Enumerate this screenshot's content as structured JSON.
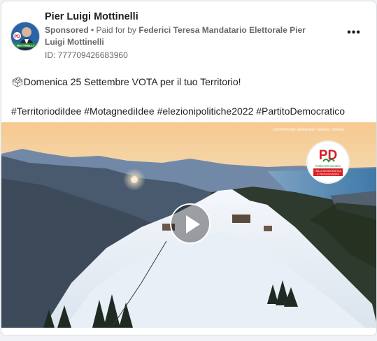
{
  "post": {
    "author": "Pier Luigi Mottinelli",
    "sponsored": "Sponsored",
    "paid_for_prefix": " • Paid for by ",
    "paid_for": "Federici Teresa Mandatario Elettorale Pier Luigi Mottinelli",
    "ad_id": "ID: 777709426683960",
    "more_label": "•••",
    "text_line1": "🗳Domenica 25 Settembre VOTA per il tuo Territorio!",
    "text_line2": "#TerritoriodiIdee #MotagnediIdee #elezionipolitiche2022 #PartitoDemocratico"
  },
  "avatar": {
    "badge": "PD",
    "caption": "MOTTINELLI"
  },
  "video": {
    "watermark": "committente elettorale Federici Teresa",
    "logo_text": "PD",
    "logo_caption_1": "Partito Democratico",
    "logo_caption_2": "ITALIA DEMOCRATICA",
    "logo_caption_3": "E PROGRESSISTA"
  },
  "colors": {
    "text": "#1c1e21",
    "secondary": "#65676b",
    "pd_red": "#d71f26",
    "pd_green": "#2e8b3a"
  }
}
